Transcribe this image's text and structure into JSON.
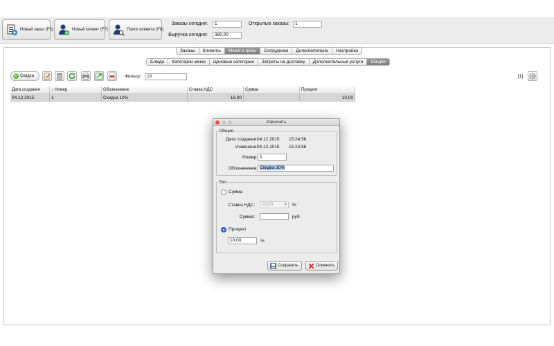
{
  "toolbar": {
    "new_order": "Новый заказ (F5)",
    "new_client": "Новый клиент (F7)",
    "search_client": "Поиск клиента (F8)"
  },
  "stats": {
    "orders_today_label": "Заказы сегодня:",
    "orders_today_value": "1",
    "open_orders_label": "Открытые заказы:",
    "open_orders_value": "1",
    "revenue_today_label": "Выручка сегодня:",
    "revenue_today_value": "380,00"
  },
  "main_tabs": [
    "Заказы",
    "Клиенты",
    "Меню и цены",
    "Сотрудники",
    "Дополнительно",
    "Настройки"
  ],
  "main_tab_active": "Меню и цены",
  "sub_tabs": [
    "Блюда",
    "Категории меню",
    "Ценовые категории",
    "Затраты на доставку",
    "Дополнительные услуги",
    "Скидки"
  ],
  "sub_tab_active": "Скидки",
  "list_toolbar": {
    "add_label": "Скидка",
    "filter_label": "Фильтр:",
    "filter_value": "10",
    "count": "[1]",
    "icons": [
      "edit-icon",
      "delete-icon",
      "refresh-icon",
      "print-icon",
      "export-icon",
      "pdf-icon",
      "settings-icon"
    ]
  },
  "table": {
    "columns": [
      "Дата создания",
      "↓ Номер",
      "Обозначение",
      "Ставка НДС",
      "Сумма",
      "Процент"
    ],
    "rows": [
      [
        "04.12.2015",
        "1",
        "Скидка 10%",
        "18,00",
        "",
        "10,00"
      ]
    ]
  },
  "dialog": {
    "title": "Изменить",
    "general_legend": "Общие",
    "created_label": "Дата создания:",
    "created_date": "04.12.2015",
    "created_time": "15:24:56",
    "modified_label": "Изменено:",
    "modified_date": "04.12.2015",
    "modified_time": "15:24:56",
    "number_label": "Номер:",
    "number_value": "1",
    "name_label": "Обозначение:",
    "name_value": "Скидка 10%",
    "type_legend": "Тип",
    "sum_option": "Сумма",
    "vat_label": "Ставка НДС:",
    "vat_value": "18,00",
    "vat_unit": "%",
    "sum_label": "Сумма:",
    "sum_value": "",
    "sum_unit": "руб.",
    "percent_option": "Процент",
    "percent_value": "10,00",
    "percent_unit": "%",
    "save_label": "Сохранить",
    "cancel_label": "Отменить"
  },
  "colors": {
    "accent": "#2a64bf",
    "selected_row": "#d6d6d6",
    "active_tab": "#8a8a8a"
  }
}
